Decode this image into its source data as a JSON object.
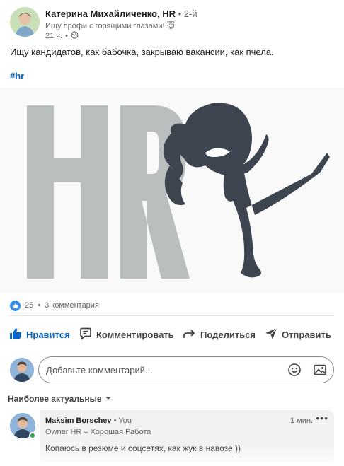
{
  "author": {
    "name": "Катерина Михайличенко, HR",
    "degree": "2-й",
    "headline": "Ищу профи с горящими глазами! 😇",
    "time": "21 ч.",
    "visibility_icon": "globe-icon"
  },
  "post": {
    "text": "Ищу кандидатов, как бабочка, закрываю вакансии, как пчела.",
    "hashtag": "#hr",
    "image": {
      "letters": "HR",
      "letters_color": "#b9bfbf",
      "figure_color": "#3d4550"
    }
  },
  "social": {
    "reactions_count": "25",
    "comments_count": "3 комментария"
  },
  "actions": {
    "like": "Нравится",
    "comment": "Комментировать",
    "share": "Поделиться",
    "send": "Отправить"
  },
  "comment_box": {
    "placeholder": "Добавьте комментарий..."
  },
  "sort": {
    "label": "Наиболее актуальные"
  },
  "comments": [
    {
      "name": "Maksim Borschev",
      "you": "You",
      "title": "Owner HR – Хорошая Работа",
      "time": "1 мин.",
      "text": "Копаюсь в резюме и соцсетях, как жук в навозе ))"
    }
  ],
  "colors": {
    "accent": "#0a66c2",
    "like_badge": "#378fe9",
    "online": "#2e9b49"
  }
}
